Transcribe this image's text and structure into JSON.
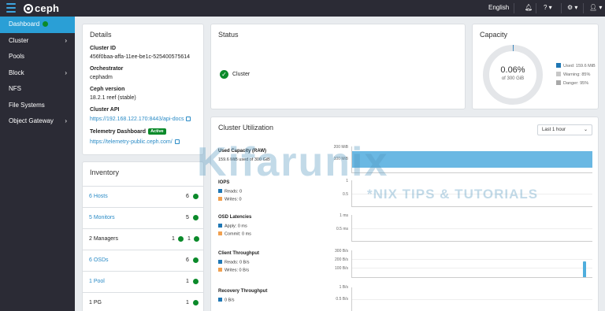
{
  "brand": {
    "name": "ceph"
  },
  "topbar": {
    "language": "English"
  },
  "sidebar": {
    "items": [
      {
        "label": "Dashboard",
        "active": true,
        "submenu": false
      },
      {
        "label": "Cluster",
        "active": false,
        "submenu": true
      },
      {
        "label": "Pools",
        "active": false,
        "submenu": false
      },
      {
        "label": "Block",
        "active": false,
        "submenu": true
      },
      {
        "label": "NFS",
        "active": false,
        "submenu": false
      },
      {
        "label": "File Systems",
        "active": false,
        "submenu": false
      },
      {
        "label": "Object Gateway",
        "active": false,
        "submenu": true
      }
    ]
  },
  "details": {
    "title": "Details",
    "cluster_id_label": "Cluster ID",
    "cluster_id": "456f0baa-affa-11ee-be1c-525400575614",
    "orchestrator_label": "Orchestrator",
    "orchestrator": "cephadm",
    "version_label": "Ceph version",
    "version": "18.2.1 reef (stable)",
    "api_label": "Cluster API",
    "api_url": "https://192.168.122.170:8443/api-docs",
    "telemetry_label": "Telemetry Dashboard",
    "telemetry_badge": "Active",
    "telemetry_url": "https://telemetry-public.ceph.com/"
  },
  "status": {
    "title": "Status",
    "cluster_label": "Cluster"
  },
  "capacity": {
    "title": "Capacity",
    "percent": "0.06%",
    "of_total": "of 300 GiB",
    "used_fraction": 0.0006,
    "legend": [
      {
        "label": "Used: 159.6 MiB",
        "color": "#1f77b4"
      },
      {
        "label": "Warning: 85%",
        "color": "#c7c7c7"
      },
      {
        "label": "Danger: 95%",
        "color": "#a8a8a8"
      }
    ]
  },
  "inventory": {
    "title": "Inventory",
    "rows": [
      {
        "label": "6 Hosts",
        "link": true,
        "count": "6",
        "extra": null
      },
      {
        "label": "5 Monitors",
        "link": true,
        "count": "5",
        "extra": null
      },
      {
        "label": "2 Managers",
        "link": false,
        "count": "1",
        "extra": "1"
      },
      {
        "label": "6 OSDs",
        "link": true,
        "count": "6",
        "extra": null
      },
      {
        "label": "1 Pool",
        "link": true,
        "count": "1",
        "extra": null
      },
      {
        "label": "1 PG",
        "link": false,
        "count": "1",
        "extra": null
      }
    ]
  },
  "utilization": {
    "title": "Cluster Utilization",
    "range_select": "Last 1 hour",
    "metrics": [
      {
        "title": "Used Capacity (RAW)",
        "sub": [
          "159.6 MiB used of 300 GiB"
        ],
        "ticks": [
          "200 MiB",
          "100 MiB"
        ]
      },
      {
        "title": "IOPS",
        "sub": [
          "Reads: 0",
          "Writes: 0"
        ],
        "ticks": [
          "1",
          "0.5"
        ]
      },
      {
        "title": "OSD Latencies",
        "sub": [
          "Apply: 0 ms",
          "Commit: 0 ms"
        ],
        "ticks": [
          "1 ms",
          "0.5 ms"
        ]
      },
      {
        "title": "Client Throughput",
        "sub": [
          "Reads: 0 B/s",
          "Writes: 0 B/s"
        ],
        "ticks": [
          "300 B/s",
          "200 B/s",
          "100 B/s"
        ]
      },
      {
        "title": "Recovery Throughput",
        "sub": [
          "0 B/s"
        ],
        "ticks": [
          "1 B/s",
          "0.5 B/s"
        ]
      }
    ],
    "colors": {
      "primary": "#1f77b4",
      "secondary": "#f0a050",
      "fill": "#4faedd"
    }
  },
  "watermark": {
    "title": "Kifarunix",
    "subtitle": "*NIX TIPS & TUTORIALS"
  }
}
